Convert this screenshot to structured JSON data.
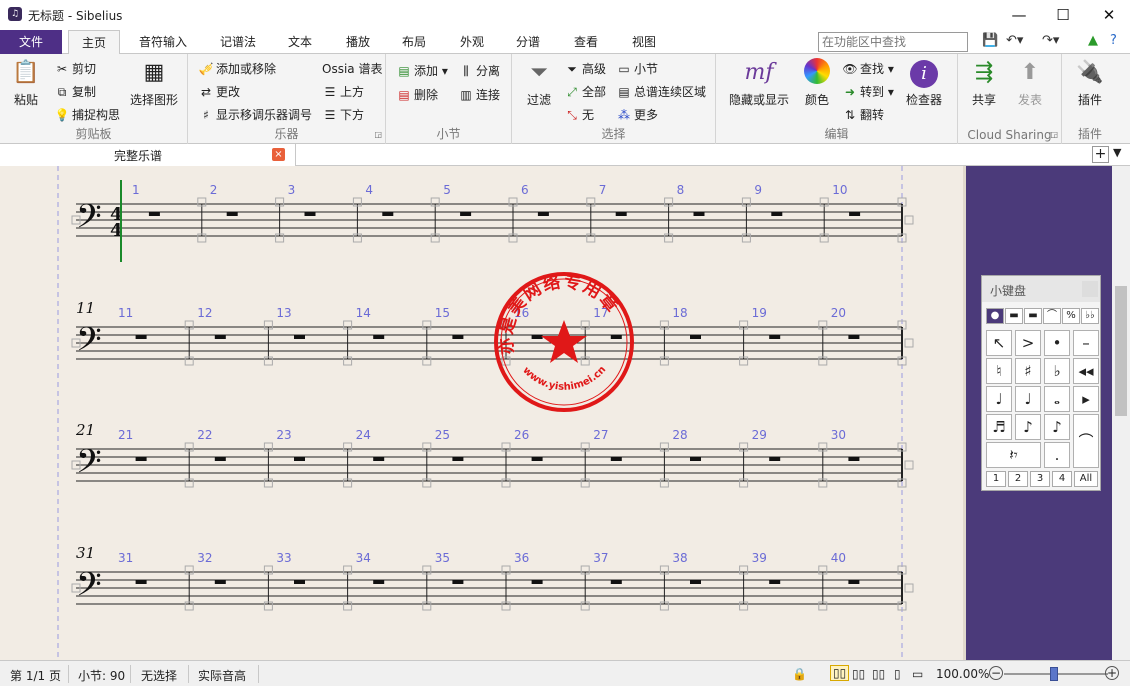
{
  "window": {
    "title": "无标题 - Sibelius",
    "icon": "sibelius-logo-icon",
    "controls": [
      "minimize-icon",
      "maximize-icon",
      "close-icon"
    ]
  },
  "ribbon": {
    "file_tab": "文件",
    "tabs": [
      "主页",
      "音符输入",
      "记谱法",
      "文本",
      "播放",
      "布局",
      "外观",
      "分谱",
      "查看",
      "视图"
    ],
    "active_tab": "主页",
    "search_placeholder": "在功能区中查找",
    "qat": [
      "save-icon",
      "undo-icon",
      "redo-icon"
    ],
    "groups": {
      "clipboard": {
        "label": "剪贴板",
        "paste": "粘贴",
        "cut": "剪切",
        "copy": "复制",
        "capture": "捕捉构思",
        "select_graphic": "选择图形"
      },
      "instruments": {
        "label": "乐器",
        "add_remove": "添加或移除",
        "change": "更改",
        "transpose": "显示移调乐器调号",
        "ossia": "Ossia 谱表",
        "above": "上方",
        "below": "下方"
      },
      "bars": {
        "label": "小节",
        "add": "添加",
        "delete": "删除",
        "split": "分离",
        "join": "连接"
      },
      "select": {
        "label": "选择",
        "filter": "过滤",
        "advanced": "高级",
        "all": "全部",
        "none": "无",
        "bar": "小节",
        "system_passage": "总谱连续区域",
        "more": "更多"
      },
      "edit": {
        "label": "编辑",
        "hide_show": "隐藏或显示",
        "color": "颜色",
        "find": "查找",
        "goto": "转到",
        "flip": "翻转",
        "inspector": "检查器"
      },
      "cloud": {
        "label": "Cloud Sharing",
        "share": "共享",
        "publish": "发表"
      },
      "plugins": {
        "label": "插件",
        "plugins": "插件"
      }
    }
  },
  "document_tab": {
    "label": "完整乐谱",
    "close": "×"
  },
  "score": {
    "systems": [
      {
        "start_label": "",
        "bars": [
          "1",
          "2",
          "3",
          "4",
          "5",
          "6",
          "7",
          "8",
          "9",
          "10"
        ]
      },
      {
        "start_label": "11",
        "bars": [
          "11",
          "12",
          "13",
          "14",
          "15",
          "16",
          "17",
          "18",
          "19",
          "20"
        ]
      },
      {
        "start_label": "21",
        "bars": [
          "21",
          "22",
          "23",
          "24",
          "25",
          "26",
          "27",
          "28",
          "29",
          "30"
        ]
      },
      {
        "start_label": "31",
        "bars": [
          "31",
          "32",
          "33",
          "34",
          "35",
          "36",
          "37",
          "38",
          "39",
          "40"
        ]
      }
    ],
    "clef": "𝄢",
    "time_signature": "4/4",
    "accent_color": "#6b6bd6"
  },
  "stamp": {
    "text": "亦是美网络专用章",
    "url": "www.yishimei.cn",
    "color": "#e01818"
  },
  "keypad": {
    "title": "小键盘",
    "tabs": [
      "●",
      "▬",
      "▬",
      "⌒",
      "%",
      "♭♭"
    ],
    "keys": [
      "↖",
      ">",
      "•",
      "–",
      "♮",
      "♯",
      "♭",
      "◂◂",
      "♩",
      "♩",
      "𝅝",
      "▸",
      "♬",
      "♪",
      "♪",
      "⌒",
      "𝄽𝄾",
      ".",
      ""
    ],
    "layouts": [
      "1",
      "2",
      "3",
      "4",
      "All"
    ]
  },
  "status": {
    "page": "第 1/1 页",
    "bar": "小节: 90",
    "selection": "无选择",
    "pitch": "实际音高",
    "zoom": "100.00%"
  }
}
